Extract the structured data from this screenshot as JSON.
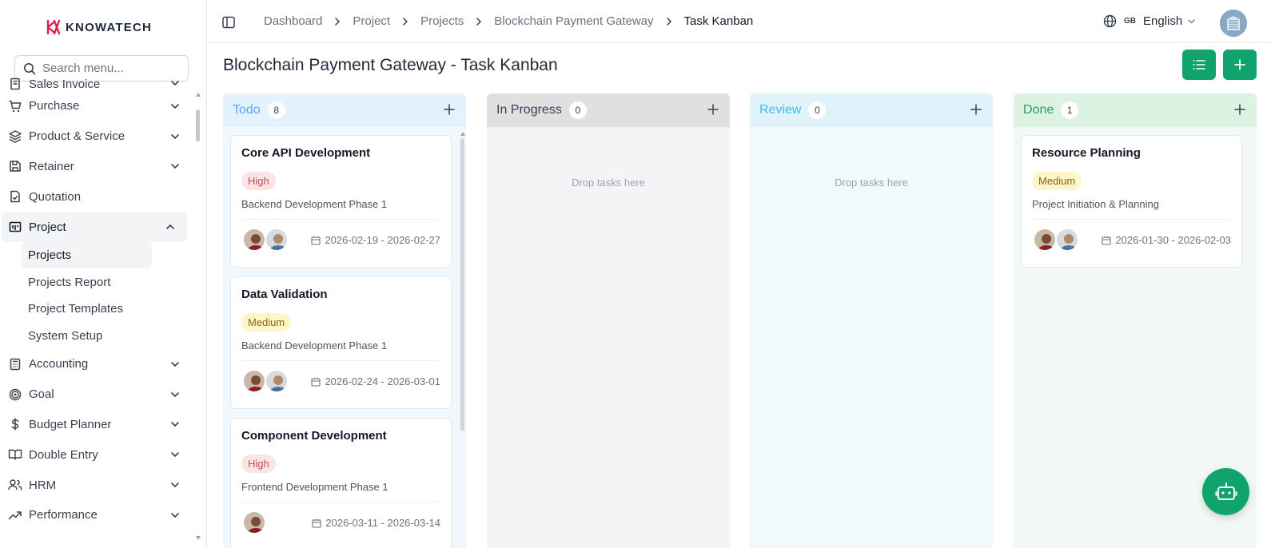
{
  "brand": {
    "name": "KNOWATECH",
    "accent": "#10a36e"
  },
  "sidebar": {
    "search_placeholder": "Search menu...",
    "items": [
      {
        "label": "Sales Invoice",
        "icon": "invoice-icon"
      },
      {
        "label": "Purchase",
        "icon": "cart-icon"
      },
      {
        "label": "Product & Service",
        "icon": "layers-icon"
      },
      {
        "label": "Retainer",
        "icon": "save-icon"
      },
      {
        "label": "Quotation",
        "icon": "file-check-icon"
      },
      {
        "label": "Project",
        "icon": "project-icon"
      }
    ],
    "project_sub": [
      "Projects",
      "Projects Report",
      "Project Templates",
      "System Setup"
    ],
    "items_after": [
      {
        "label": "Accounting",
        "icon": "calculator-icon"
      },
      {
        "label": "Goal",
        "icon": "target-icon"
      },
      {
        "label": "Budget Planner",
        "icon": "dollar-icon"
      },
      {
        "label": "Double Entry",
        "icon": "book-icon"
      },
      {
        "label": "HRM",
        "icon": "users-icon"
      },
      {
        "label": "Performance",
        "icon": "trend-icon"
      }
    ]
  },
  "topbar": {
    "breadcrumb": [
      "Dashboard",
      "Project",
      "Projects",
      "Blockchain Payment Gateway",
      "Task Kanban"
    ],
    "lang_code": "GB",
    "lang_label": "English"
  },
  "page": {
    "title": "Blockchain Payment Gateway - Task Kanban"
  },
  "columns": [
    {
      "name": "Todo",
      "count": "8"
    },
    {
      "name": "In Progress",
      "count": "0",
      "empty": "Drop tasks here"
    },
    {
      "name": "Review",
      "count": "0",
      "empty": "Drop tasks here"
    },
    {
      "name": "Done",
      "count": "1"
    }
  ],
  "cards": {
    "todo": [
      {
        "title": "Core API Development",
        "priority": "High",
        "phase": "Backend Development Phase 1",
        "dates": "2026-02-19 - 2026-02-27"
      },
      {
        "title": "Data Validation",
        "priority": "Medium",
        "phase": "Backend Development Phase 1",
        "dates": "2026-02-24 - 2026-03-01"
      },
      {
        "title": "Component Development",
        "priority": "High",
        "phase": "Frontend Development Phase 1",
        "dates": "2026-03-11 - 2026-03-14"
      }
    ],
    "done": [
      {
        "title": "Resource Planning",
        "priority": "Medium",
        "phase": "Project Initiation & Planning",
        "dates": "2026-01-30 - 2026-02-03"
      }
    ]
  }
}
